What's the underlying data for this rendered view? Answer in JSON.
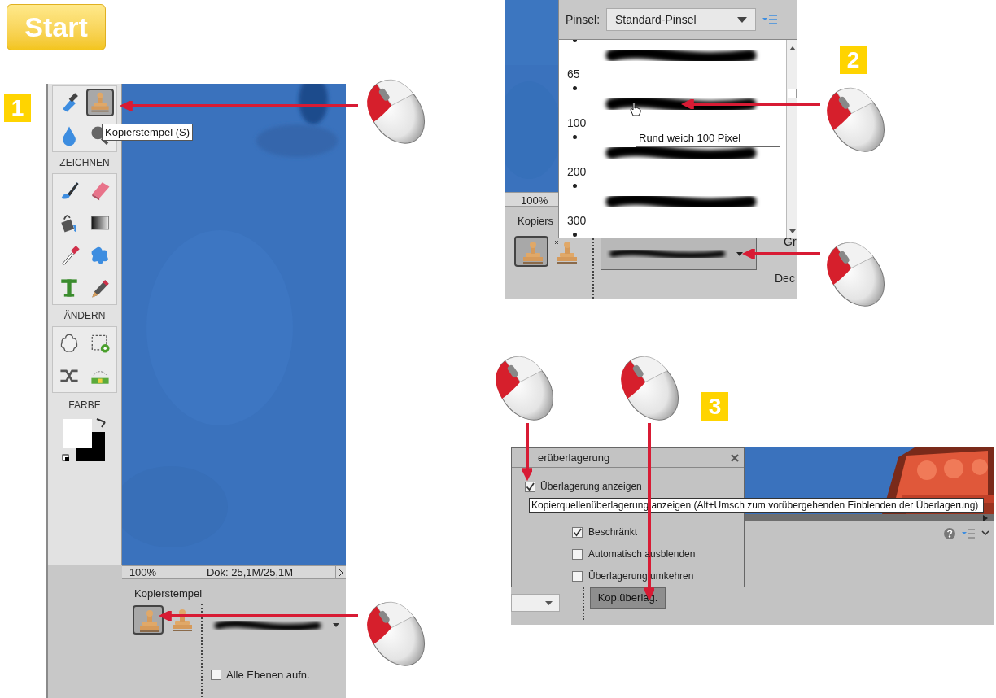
{
  "start_button": {
    "label": "Start"
  },
  "step_1": {
    "badge": "1",
    "stamp_tool_selected": true,
    "tooltip": "Kopierstempel (S)",
    "sections": [
      "ZEICHNEN",
      "ÄNDERN",
      "FARBE"
    ],
    "zoom": "100%",
    "doc_info": "Dok: 25,1M/25,1M",
    "options_title": "Kopierstempel",
    "all_layers": {
      "label": "Alle Ebenen aufn.",
      "checked": false
    }
  },
  "step_2": {
    "badge": "2",
    "brush_label": "Pinsel:",
    "brush_set": "Standard-Pinsel",
    "sizes": [
      "65",
      "100",
      "200",
      "300"
    ],
    "tooltip": "Rund weich 100 Pixel",
    "zoom": "100%",
    "options_title": "Kopiers",
    "size_label": "Gr",
    "opacity_label": "Dec"
  },
  "step_3": {
    "badge": "3",
    "panel_title": "erüberlagerung",
    "show_overlay": {
      "label": "Überlagerung anzeigen",
      "checked": true
    },
    "tooltip": "Kopierquellenüberlagerung anzeigen (Alt+Umsch zum vorübergehenden Einblenden der Überlagerung)",
    "options": [
      {
        "label": "Beschränkt",
        "checked": true
      },
      {
        "label": "Automatisch ausblenden",
        "checked": false
      },
      {
        "label": "Überlagerung umkehren",
        "checked": false
      }
    ],
    "button": "Kop.überlag."
  }
}
